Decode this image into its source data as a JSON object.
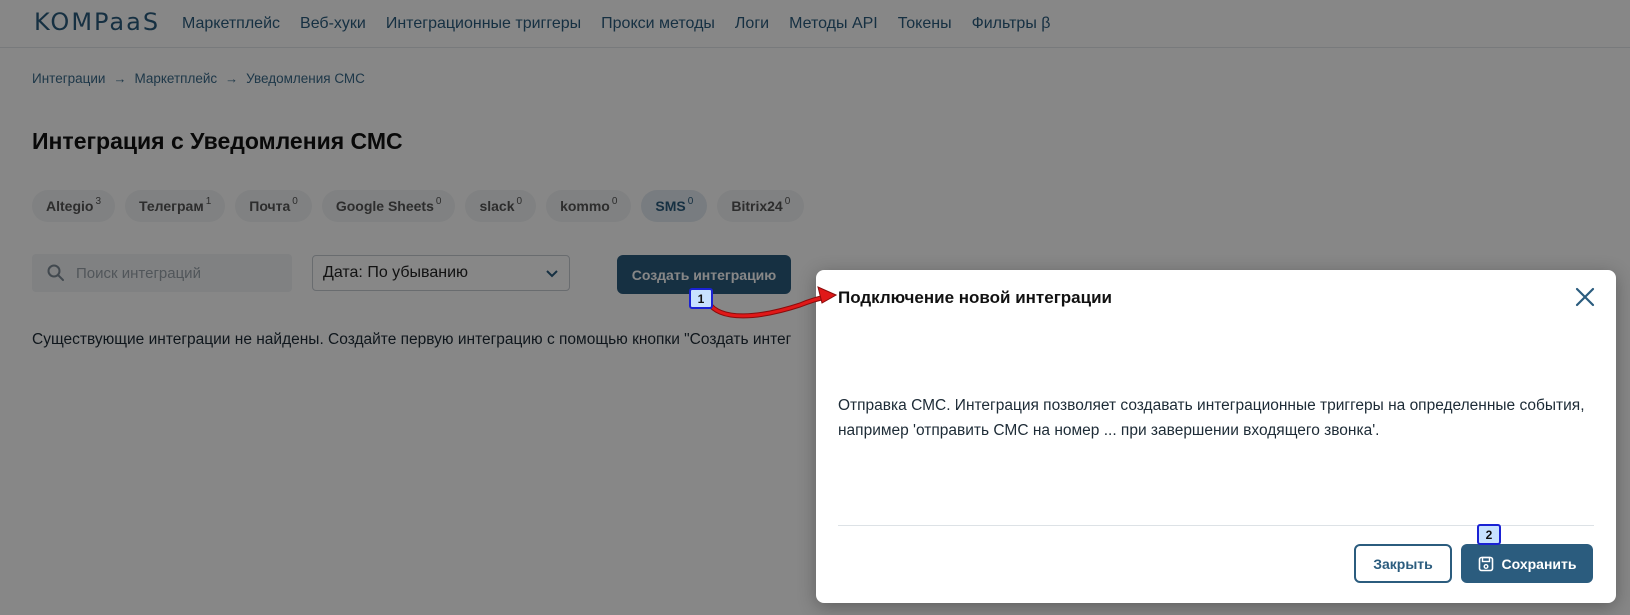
{
  "header": {
    "logo_text": "KOMPaaS",
    "nav": [
      "Маркетплейс",
      "Веб-хуки",
      "Интеграционные триггеры",
      "Прокси методы",
      "Логи",
      "Методы API",
      "Токены",
      "Фильтры β"
    ]
  },
  "breadcrumb": [
    "Интеграции",
    "Маркетплейс",
    "Уведомления СМС"
  ],
  "page_title": "Интеграция с Уведомления СМС",
  "chips": [
    {
      "label": "Altegio",
      "count": "3"
    },
    {
      "label": "Телеграм",
      "count": "1"
    },
    {
      "label": "Почта",
      "count": "0"
    },
    {
      "label": "Google Sheets",
      "count": "0"
    },
    {
      "label": "slack",
      "count": "0"
    },
    {
      "label": "kommo",
      "count": "0"
    },
    {
      "label": "SMS",
      "count": "0"
    },
    {
      "label": "Bitrix24",
      "count": "0"
    }
  ],
  "search": {
    "placeholder": "Поиск интеграций"
  },
  "sort_select": {
    "value": "Дата: По убыванию"
  },
  "create_button": "Создать интеграцию",
  "empty_message": "Существующие интеграции не найдены. Создайте первую интеграцию с помощью кнопки \"Создать интег",
  "modal": {
    "title": "Подключение новой интеграции",
    "body": "Отправка СМС. Интеграция позволяет создавать интеграционные триггеры на определенные события, например 'отправить СМС на номер ... при завершении входящего звонка'.",
    "close_button": "Закрыть",
    "save_button": "Сохранить"
  },
  "markers": [
    "1",
    "2"
  ],
  "colors": {
    "brand": "#2b5c7e",
    "annotation_arrow": "#e01818",
    "marker_border": "#1a22d4"
  }
}
